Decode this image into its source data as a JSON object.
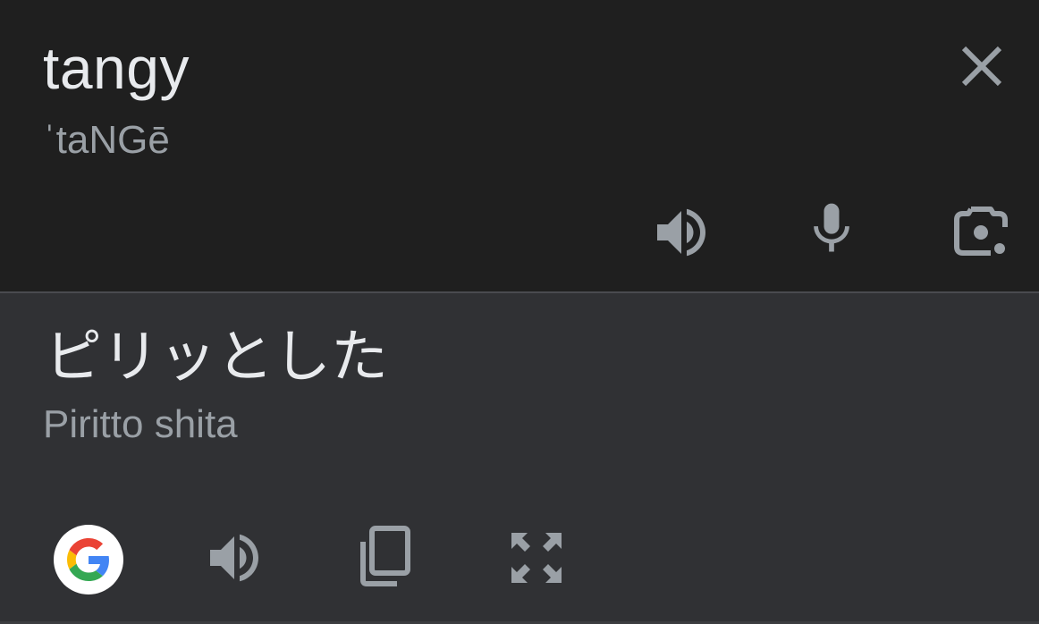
{
  "source": {
    "word": "tangy",
    "phonetic": "ˈtaNGē"
  },
  "translation": {
    "word": "ピリッとした",
    "romanization": "Piritto shita"
  },
  "icons": {
    "close": "close-icon",
    "speak_source": "speaker-icon",
    "mic": "microphone-icon",
    "lens": "camera-lens-icon",
    "google": "google-logo-icon",
    "speak_translation": "speaker-icon",
    "copy": "copy-icon",
    "expand": "fullscreen-icon"
  },
  "colors": {
    "source_bg": "#1f1f1f",
    "target_bg": "#303134",
    "primary_text": "#e8eaed",
    "secondary_text": "#9aa0a6",
    "icon": "#9aa0a6"
  }
}
